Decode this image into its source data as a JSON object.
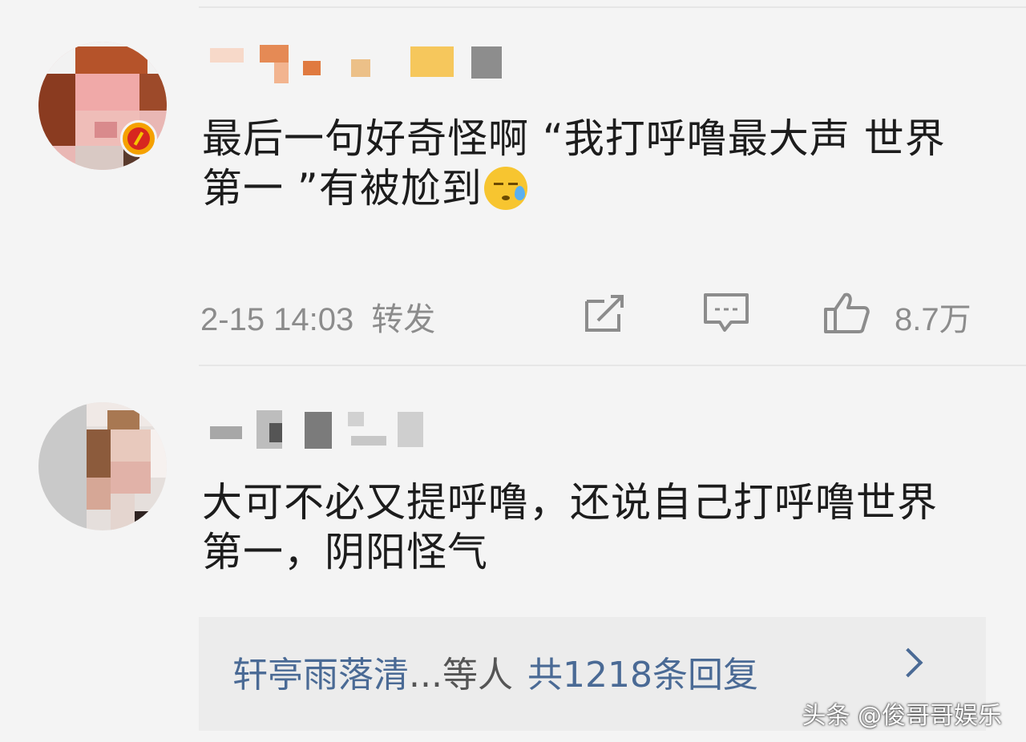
{
  "comments": [
    {
      "avatar": "pixelated-avatar",
      "verified_badge": "verified-badge-icon",
      "text": "最后一句好奇怪啊 “我打呼噜最大声 世界第一 ”有被尬到",
      "emoji": "sweat-emoji-icon",
      "timestamp": "2-15 14:03",
      "forward_label": "转发",
      "actions": {
        "share_icon": "share-icon",
        "comment_icon": "comment-icon",
        "like_icon": "thumbs-up-icon",
        "like_count": "8.7万"
      }
    },
    {
      "avatar": "pixelated-avatar",
      "text": "大可不必又提呼噜，还说自己打呼噜世界第一，阴阳怪气",
      "replies": {
        "who": "轩亭雨落清",
        "others": "...等人",
        "total": "共1218条回复",
        "chevron_icon": "chevron-right-icon"
      }
    }
  ],
  "watermark": "头条 @俊哥哥娱乐",
  "colors": {
    "background": "#f4f4f4",
    "text": "#1c1c1c",
    "meta": "#8c8c8c",
    "link": "#4a6a95",
    "reply_box": "#ececec"
  }
}
